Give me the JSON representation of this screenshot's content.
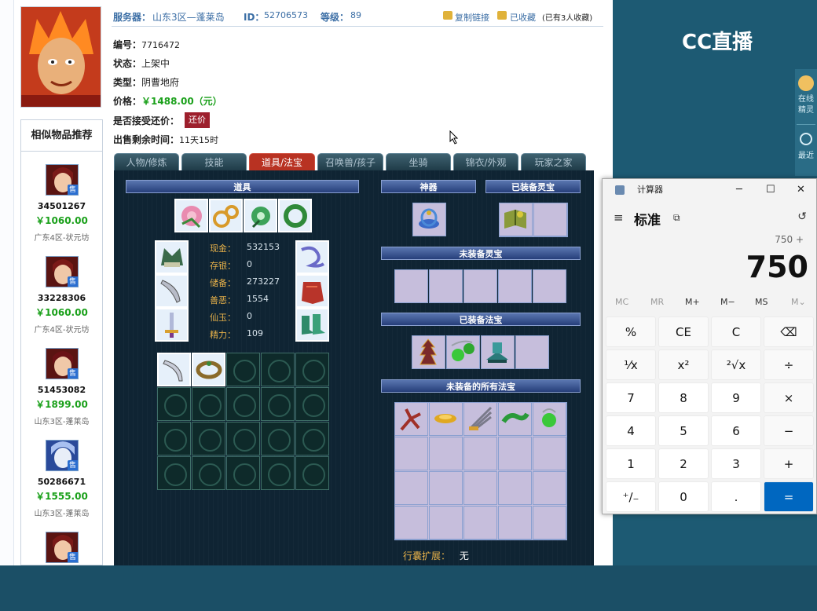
{
  "page": {
    "server_label": "服务器：",
    "server_value": "山东3区—蓬莱岛",
    "id_label": "ID：",
    "id_value": "52706573",
    "level_label": "等级：",
    "level_value": "89",
    "copy_link": "复制链接",
    "favorited": "已收藏",
    "fav_count": "(已有3人收藏)",
    "serial_label": "编号：",
    "serial_value": "7716472",
    "status_label": "状态：",
    "status_value": "上架中",
    "type_label": "类型：",
    "type_value": "阴曹地府",
    "price_label": "价格：",
    "price_value": "￥1488.00（元）",
    "haggle_label": "是否接受还价：",
    "haggle_button": "还价",
    "remain_label": "出售剩余时间：",
    "remain_value": "11天15时"
  },
  "recommend": {
    "title": "相似物品推荐",
    "badge": "售",
    "items": [
      {
        "id": "34501267",
        "price": "￥1060.00",
        "server": "广东4区-状元坊"
      },
      {
        "id": "33228306",
        "price": "￥1060.00",
        "server": "广东4区-状元坊"
      },
      {
        "id": "51453082",
        "price": "￥1899.00",
        "server": "山东3区-蓬莱岛"
      },
      {
        "id": "50286671",
        "price": "￥1555.00",
        "server": "山东3区-蓬莱岛"
      }
    ]
  },
  "tabs": [
    "人物/修炼",
    "技能",
    "道具/法宝",
    "召唤兽/孩子",
    "坐骑",
    "锦衣/外观",
    "玩家之家"
  ],
  "game": {
    "items_header": "道具",
    "artifact_header": "神器",
    "equipped_spirit_header": "已装备灵宝",
    "unequipped_spirit_header": "未装备灵宝",
    "equipped_magic_header": "已装备法宝",
    "all_magic_header": "未装备的所有法宝",
    "stats": [
      {
        "k": "现金：",
        "v": "532153"
      },
      {
        "k": "存银：",
        "v": "0"
      },
      {
        "k": "储备：",
        "v": "273227"
      },
      {
        "k": "善恶：",
        "v": "1554"
      },
      {
        "k": "仙玉：",
        "v": "0"
      },
      {
        "k": "精力：",
        "v": "109"
      }
    ],
    "bag_label": "行囊扩展：",
    "bag_value": "无"
  },
  "cc": {
    "logo": "CC直播",
    "side1": "在线精灵",
    "side2": "最近"
  },
  "calculator": {
    "title": "计算器",
    "mode": "标准",
    "expression": "750 +",
    "display": "750",
    "memory": [
      "MC",
      "MR",
      "M+",
      "M−",
      "MS",
      "M⌄"
    ],
    "keys": [
      "%",
      "CE",
      "C",
      "⌫",
      "⅟x",
      "x²",
      "²√x",
      "÷",
      "7",
      "8",
      "9",
      "×",
      "4",
      "5",
      "6",
      "−",
      "1",
      "2",
      "3",
      "+",
      "⁺∕₋",
      "0",
      ".",
      "="
    ]
  },
  "colors": {
    "accent_red": "#b83222",
    "price_green": "#1aa01a",
    "link_blue": "#3b6ea5",
    "calc_equals": "#0067c0"
  }
}
